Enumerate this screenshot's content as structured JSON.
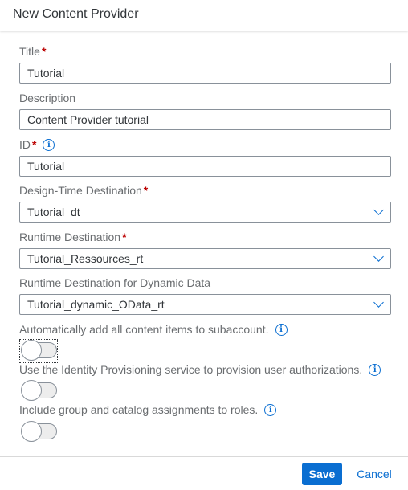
{
  "dialog": {
    "title": "New Content Provider"
  },
  "fields": {
    "title": {
      "label": "Title",
      "required_mark": "*",
      "value": "Tutorial"
    },
    "description": {
      "label": "Description",
      "value": "Content Provider tutorial"
    },
    "id": {
      "label": "ID",
      "required_mark": "*",
      "value": "Tutorial",
      "info_icon": "i"
    },
    "design_time_destination": {
      "label": "Design-Time Destination",
      "required_mark": "*",
      "value": "Tutorial_dt"
    },
    "runtime_destination": {
      "label": "Runtime Destination",
      "required_mark": "*",
      "value": "Tutorial_Ressources_rt"
    },
    "runtime_destination_dynamic": {
      "label": "Runtime Destination for Dynamic Data",
      "value": "Tutorial_dynamic_OData_rt"
    }
  },
  "switches": {
    "auto_add": {
      "label": "Automatically add all content items to subaccount.",
      "info_icon": "i",
      "on": false,
      "focused": true
    },
    "identity_provisioning": {
      "label": "Use the Identity Provisioning service to provision user authorizations.",
      "info_icon": "i",
      "on": false
    },
    "group_catalog": {
      "label": "Include group and catalog assignments to roles.",
      "info_icon": "i",
      "on": false
    }
  },
  "footer": {
    "save_label": "Save",
    "cancel_label": "Cancel"
  },
  "colors": {
    "accent": "#0a6ed1",
    "required": "#bb0000",
    "label": "#6a6d70",
    "text": "#32363a"
  }
}
